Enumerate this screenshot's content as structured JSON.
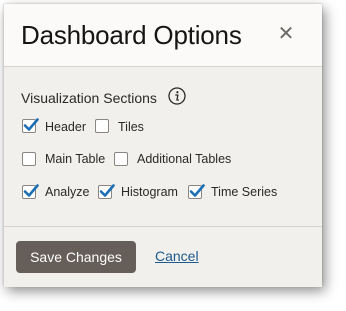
{
  "dialog": {
    "title": "Dashboard Options",
    "close_icon": "close-icon",
    "section_label": "Visualization Sections",
    "info_icon": "info-icon",
    "checkboxes": [
      {
        "label": "Header",
        "checked": true
      },
      {
        "label": "Tiles",
        "checked": false
      },
      {
        "label": "Main Table",
        "checked": false
      },
      {
        "label": "Additional Tables",
        "checked": false
      },
      {
        "label": "Analyze",
        "checked": true
      },
      {
        "label": "Histogram",
        "checked": true
      },
      {
        "label": "Time Series",
        "checked": true
      }
    ],
    "save_label": "Save Changes",
    "cancel_label": "Cancel"
  },
  "colors": {
    "check_accent": "#1c6fb4",
    "primary_button": "#665e58",
    "link": "#1d5a8c"
  }
}
